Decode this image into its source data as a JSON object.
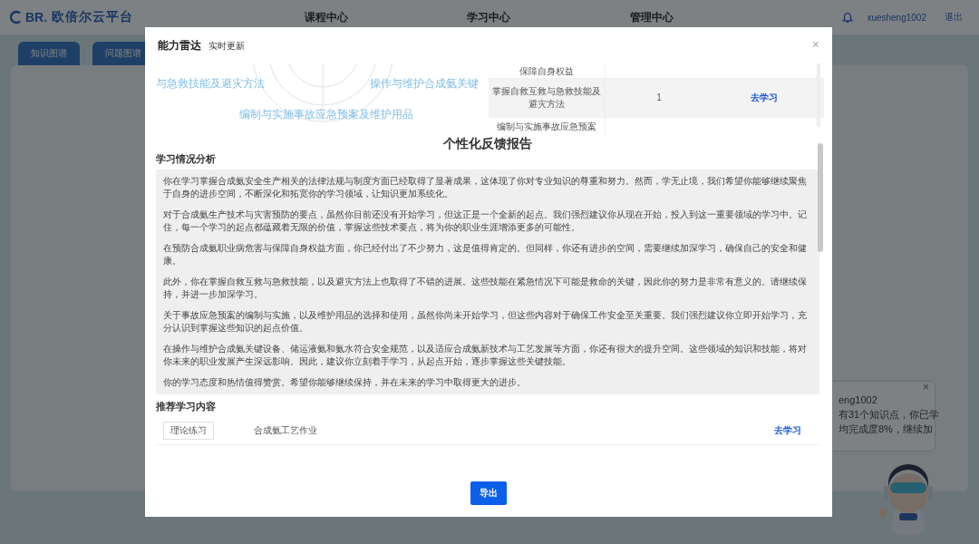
{
  "header": {
    "logo": "BR.",
    "site": "欧倍尔云平台",
    "nav": [
      "课程中心",
      "学习中心",
      "管理中心"
    ],
    "user": "xuesheng1002",
    "logout": "退出"
  },
  "tabs": [
    "知识图谱",
    "问题图谱"
  ],
  "bubble": {
    "lines": [
      "eng1002",
      "有31个知识点，你已学",
      "均完成度8%，继续加"
    ],
    "close": "×"
  },
  "modal": {
    "title": "能力雷达",
    "subtitle": "实时更新",
    "close": "×",
    "radar": {
      "labels": [
        "与急救技能及避灾方法",
        "操作与维护合成氨关键",
        "编制与实施事故应急预案及维护用品"
      ]
    },
    "table": {
      "rows": [
        {
          "name": "保障自身权益",
          "count": "",
          "action": "",
          "selected": false
        },
        {
          "name": "掌握自救互救与急救技能及避灾方法",
          "count": "1",
          "action": "去学习",
          "selected": true
        },
        {
          "name": "编制与实施事故应急预案",
          "count": "",
          "action": "",
          "selected": false
        }
      ]
    },
    "report": {
      "title": "个性化反馈报告",
      "analysis_heading": "学习情况分析",
      "paragraphs": [
        "你在学习掌握合成氨安全生产相关的法律法规与制度方面已经取得了显著成果，这体现了你对专业知识的尊重和努力。然而，学无止境，我们希望你能够继续聚焦于自身的进步空间，不断深化和拓宽你的学习领域，让知识更加系统化。",
        "对于合成氨生产技术与灾害预防的要点，虽然你目前还没有开始学习，但这正是一个全新的起点。我们强烈建议你从现在开始，投入到这一重要领域的学习中。记住，每一个学习的起点都蕴藏着无限的价值，掌握这些技术要点，将为你的职业生涯增添更多的可能性。",
        "在预防合成氨职业病危害与保障自身权益方面，你已经付出了不少努力，这是值得肯定的。但同样，你还有进步的空间，需要继续加深学习，确保自己的安全和健康。",
        "此外，你在掌握自救互救与急救技能，以及避灾方法上也取得了不错的进展。这些技能在紧急情况下可能是救命的关键，因此你的努力是非常有意义的。请继续保持，并进一步加深学习。",
        "关于事故应急预案的编制与实施，以及维护用品的选择和使用，虽然你尚未开始学习，但这些内容对于确保工作安全至关重要。我们强烈建议你立即开始学习，充分认识到掌握这些知识的起点价值。",
        "在操作与维护合成氨关键设备、储运液氨和氨水符合安全规范，以及适应合成氨新技术与工艺发展等方面，你还有很大的提升空间。这些领域的知识和技能，将对你未来的职业发展产生深远影响。因此，建议你立刻着手学习，从起点开始，逐步掌握这些关键技能。",
        "你的学习态度和热情值得赞赏。希望你能够继续保持，并在未来的学习中取得更大的进步。"
      ],
      "recommend_heading": "推荐学习内容",
      "items": [
        {
          "tag": "理论练习",
          "name": "合成氨工艺作业",
          "action": "去学习"
        }
      ]
    },
    "export": "导出"
  }
}
